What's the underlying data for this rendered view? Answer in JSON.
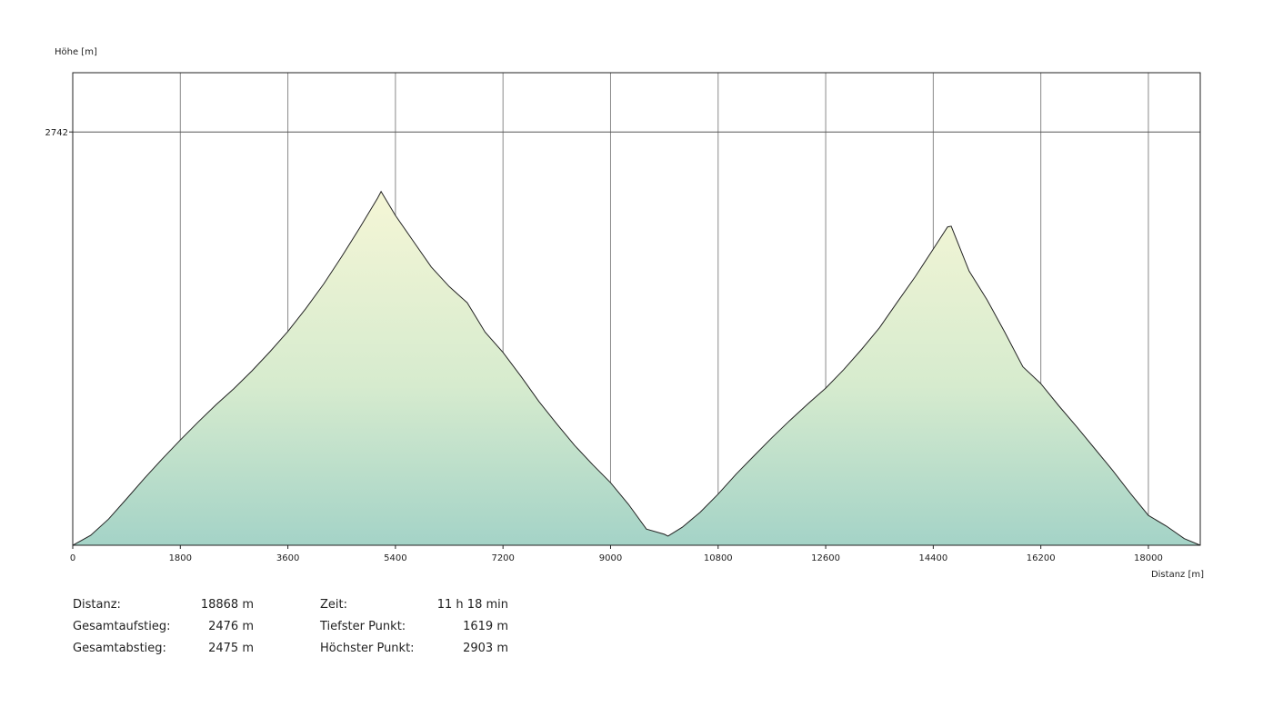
{
  "chart_data": {
    "type": "area",
    "ylabel": "Höhe [m]",
    "xlabel": "Distanz [m]",
    "xlim": [
      0,
      18868
    ],
    "ylim": [
      1619,
      2903
    ],
    "x_ticks": [
      0,
      1800,
      3600,
      5400,
      7200,
      9000,
      10800,
      12600,
      14400,
      16200,
      18000
    ],
    "y_ticks": [
      2742
    ],
    "grid": true,
    "x": [
      0,
      300,
      600,
      900,
      1200,
      1500,
      1800,
      2100,
      2400,
      2700,
      3000,
      3300,
      3600,
      3900,
      4200,
      4500,
      4800,
      5100,
      5160,
      5400,
      5700,
      6000,
      6300,
      6600,
      6900,
      7200,
      7500,
      7800,
      8100,
      8400,
      8700,
      9000,
      9300,
      9600,
      9900,
      9960,
      10200,
      10500,
      10800,
      11100,
      11400,
      11700,
      12000,
      12300,
      12600,
      12900,
      13200,
      13500,
      13800,
      14100,
      14400,
      14640,
      14700,
      15000,
      15300,
      15600,
      15900,
      16200,
      16500,
      16800,
      17100,
      17400,
      17700,
      18000,
      18300,
      18600,
      18868
    ],
    "y": [
      1619,
      1646,
      1690,
      1745,
      1801,
      1854,
      1905,
      1954,
      2001,
      2045,
      2093,
      2145,
      2200,
      2262,
      2329,
      2403,
      2481,
      2562,
      2580,
      2515,
      2445,
      2375,
      2322,
      2278,
      2198,
      2143,
      2078,
      2010,
      1949,
      1890,
      1838,
      1789,
      1730,
      1663,
      1649,
      1644,
      1668,
      1709,
      1758,
      1812,
      1862,
      1911,
      1958,
      2003,
      2046,
      2096,
      2151,
      2210,
      2280,
      2349,
      2424,
      2484,
      2486,
      2364,
      2286,
      2197,
      2104,
      2058,
      1998,
      1941,
      1882,
      1823,
      1760,
      1700,
      1671,
      1637,
      1619
    ]
  },
  "stats": {
    "distance_label": "Distanz:",
    "distance_value": "18868 m",
    "ascent_label": "Gesamtaufstieg:",
    "ascent_value": "2476 m",
    "descent_label": "Gesamtabstieg:",
    "descent_value": "2475 m",
    "time_label": "Zeit:",
    "time_value": "11 h 18 min",
    "lowest_label": "Tiefster Punkt:",
    "lowest_value": "1619 m",
    "highest_label": "Höchster Punkt:",
    "highest_value": "2903 m"
  },
  "colors": {
    "fill_bottom": "#a4d3c7",
    "fill_top": "#f5f6d6",
    "line": "#222222",
    "grid": "#8a8a8a"
  }
}
